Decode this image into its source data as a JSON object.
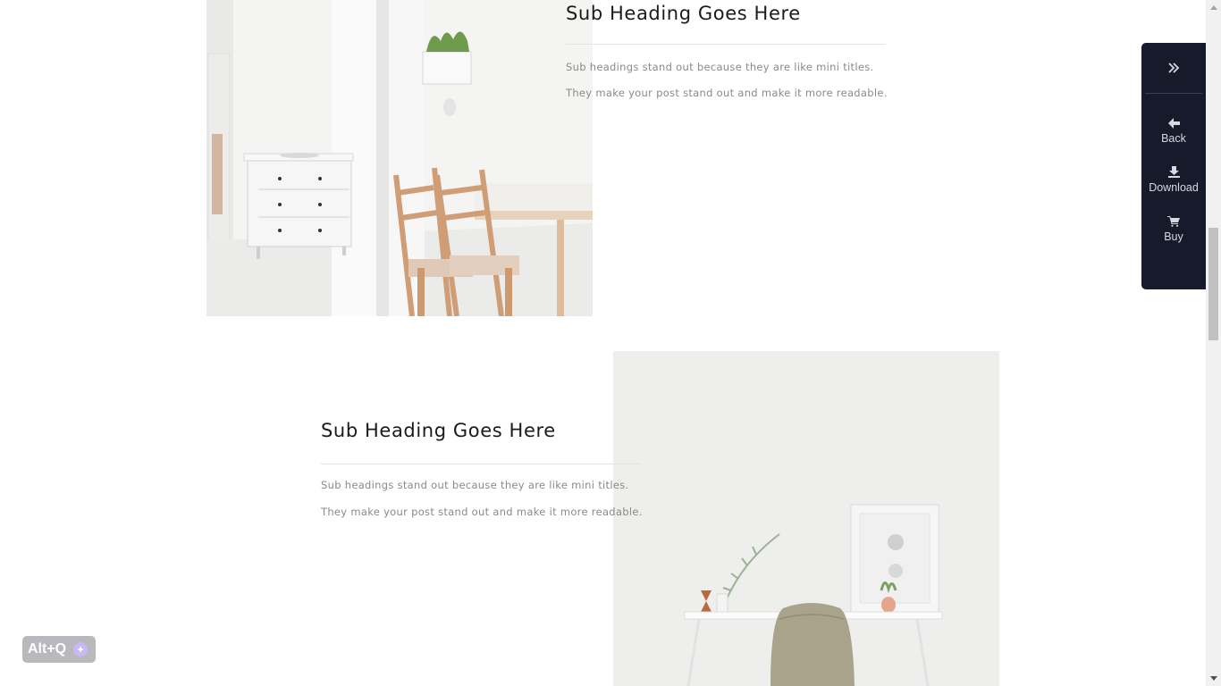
{
  "sections": [
    {
      "heading": "Sub Heading Goes Here",
      "paragraphs": [
        "Sub headings stand out because they are like mini titles.",
        "They make your post stand out and make it more readable."
      ]
    },
    {
      "heading": "Sub Heading Goes Here",
      "paragraphs": [
        "Sub headings stand out because they are like mini titles.",
        "They make your post stand out and make it more readable."
      ]
    }
  ],
  "side_panel": {
    "items": [
      {
        "label": "Back",
        "icon": "arrow-left-icon"
      },
      {
        "label": "Download",
        "icon": "download-icon"
      },
      {
        "label": "Buy",
        "icon": "cart-icon"
      }
    ],
    "toggle_icon": "double-chevron-right-icon",
    "background": "#161a2b"
  },
  "shortcut_badge": {
    "label": "Alt+Q"
  }
}
